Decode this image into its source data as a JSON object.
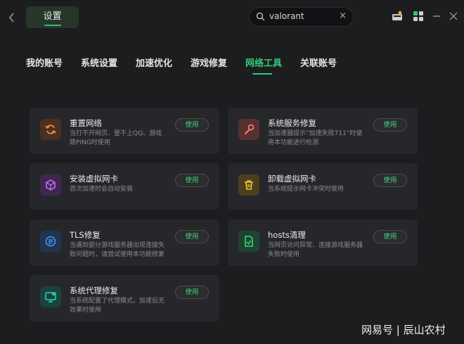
{
  "header": {
    "back_icon": "chevron-left-icon",
    "settings_tab": "设置",
    "search_value": "valorant",
    "search_icon": "search-icon",
    "clear_icon": "close-icon"
  },
  "tabs": [
    {
      "label": "我的账号",
      "active": false
    },
    {
      "label": "系统设置",
      "active": false
    },
    {
      "label": "加速优化",
      "active": false
    },
    {
      "label": "游戏修复",
      "active": false
    },
    {
      "label": "网络工具",
      "active": true
    },
    {
      "label": "关联账号",
      "active": false
    }
  ],
  "tools": [
    {
      "title": "重置网络",
      "desc": "当打不开网页、登不上QQ、游戏跳PING时使用",
      "button": "使用",
      "icon": "refresh-icon",
      "color": "#f08a34",
      "bg": "#4a3020"
    },
    {
      "title": "系统服务修复",
      "desc": "当加速器提示“加速失败711”时使用本功能进行检测",
      "button": "使用",
      "icon": "wrench-icon",
      "color": "#ff7a6a",
      "bg": "#553130"
    },
    {
      "title": "安装虚拟网卡",
      "desc": "首次加速时会自动安装",
      "button": "使用",
      "icon": "cube-icon",
      "color": "#c06cf0",
      "bg": "#40274f"
    },
    {
      "title": "卸载虚拟网卡",
      "desc": "当系统提示网卡冲突时使用",
      "button": "使用",
      "icon": "trash-icon",
      "color": "#f2c73a",
      "bg": "#4b3f1b"
    },
    {
      "title": "TLS修复",
      "desc": "当遇到部分游戏服务器出现连接失败问题时，请尝试使用本功能修复",
      "button": "使用",
      "icon": "tls-icon",
      "color": "#3f9af0",
      "bg": "#1f3550"
    },
    {
      "title": "hosts清理",
      "desc": "当网页访问异常、连接游戏服务器失败时使用",
      "button": "使用",
      "icon": "document-check-icon",
      "color": "#3ed27a",
      "bg": "#1d4430"
    },
    {
      "title": "系统代理修复",
      "desc": "当系统配置了代理模式，加速后无效果时使用",
      "button": "使用",
      "icon": "monitor-icon",
      "color": "#2fd0b0",
      "bg": "#19433e"
    }
  ],
  "watermark": "网易号 | 辰山农村"
}
